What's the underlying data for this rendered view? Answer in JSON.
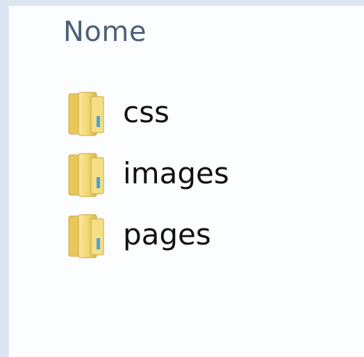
{
  "columns": {
    "name_header": "Nome"
  },
  "items": [
    {
      "name": "css",
      "icon": "folder-icon"
    },
    {
      "name": "images",
      "icon": "folder-icon"
    },
    {
      "name": "pages",
      "icon": "folder-icon"
    }
  ],
  "colors": {
    "window_bg": "#fcfdfe",
    "frame_bg": "#dce6f2",
    "header_text": "#4c607a",
    "folder_fill": "#f0d76b"
  }
}
